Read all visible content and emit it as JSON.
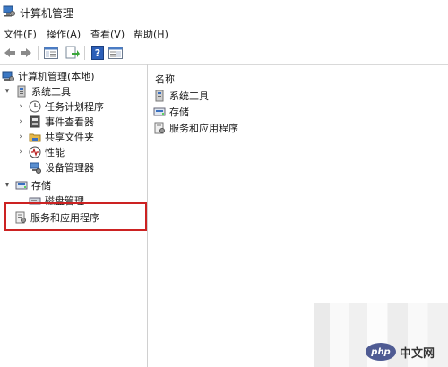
{
  "window": {
    "title": "计算机管理",
    "icon": "computer-management-icon"
  },
  "menu": [
    {
      "label": "文件(F)"
    },
    {
      "label": "操作(A)"
    },
    {
      "label": "查看(V)"
    },
    {
      "label": "帮助(H)"
    }
  ],
  "toolbar": {
    "buttons": [
      "back-arrow-icon",
      "forward-arrow-icon",
      "show-tree-icon",
      "export-list-icon",
      "help-icon",
      "properties-pane-icon"
    ]
  },
  "tree": {
    "root": "计算机管理(本地)",
    "system_tools": "系统工具",
    "task_scheduler": "任务计划程序",
    "event_viewer": "事件查看器",
    "shared_folders": "共享文件夹",
    "performance": "性能",
    "device_manager": "设备管理器",
    "storage": "存储",
    "disk_management": "磁盘管理",
    "services_apps": "服务和应用程序"
  },
  "list": {
    "column_name": "名称",
    "items": [
      "系统工具",
      "存储",
      "服务和应用程序"
    ]
  },
  "watermark": {
    "php": "php",
    "text": "中文网"
  },
  "colors": {
    "highlight": "#cc2222"
  }
}
